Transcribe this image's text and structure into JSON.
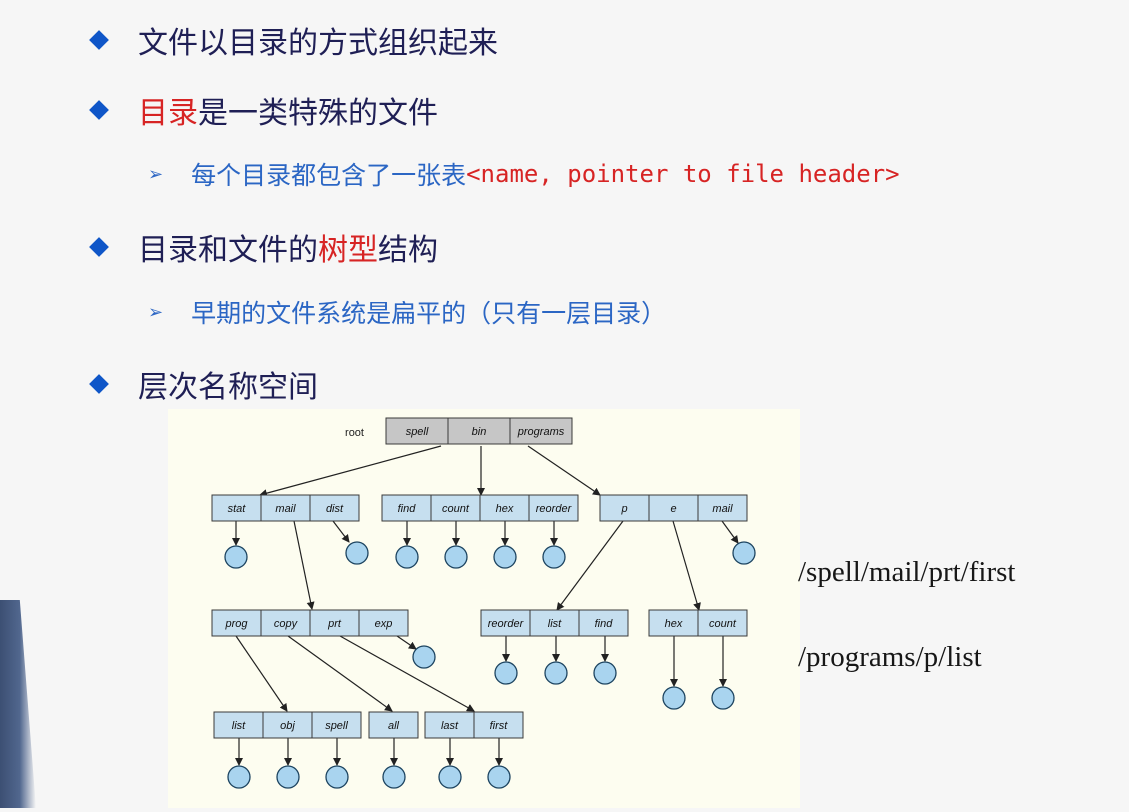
{
  "bullets": [
    {
      "text": "文件以目录的方式组织起来"
    },
    {
      "red": "目录",
      "rest": "是一类特殊的文件"
    },
    {
      "pre": "目录和文件的",
      "red": "树型",
      "post": "结构"
    },
    {
      "text": "层次名称空间"
    }
  ],
  "subs": [
    {
      "text": "每个目录都包含了一张表",
      "code": "<name, pointer to file header>"
    },
    {
      "text": "早期的文件系统是扁平的（只有一层目录）"
    }
  ],
  "tree": {
    "root_label": "root",
    "root_cells": [
      "spell",
      "bin",
      "programs"
    ],
    "dir_spell": [
      "stat",
      "mail",
      "dist"
    ],
    "dir_bin": [
      "find",
      "count",
      "hex",
      "reorder"
    ],
    "dir_programs": [
      "p",
      "e",
      "mail"
    ],
    "dir_mail": [
      "prog",
      "copy",
      "prt",
      "exp"
    ],
    "dir_p": [
      "reorder",
      "list",
      "find"
    ],
    "dir_e": [
      "hex",
      "count"
    ],
    "dir_prog": [
      "list",
      "obj",
      "spell"
    ],
    "dir_copy": [
      "all"
    ],
    "dir_prt": [
      "last",
      "first"
    ]
  },
  "paths": [
    "/spell/mail/prt/first",
    "/programs/p/list"
  ],
  "colors": {
    "bullet": "#0f56c8",
    "text": "#1f1f55",
    "sub_text": "#2b66c4",
    "highlight": "#d72424",
    "root_cell": "#c6c6c6",
    "dir_cell": "#c6dfef",
    "leaf_node": "#a9d4ef"
  }
}
